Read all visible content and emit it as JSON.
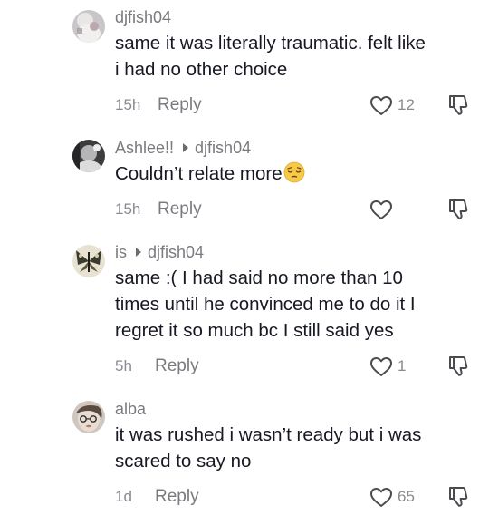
{
  "comments": [
    {
      "username": "djfish04",
      "reply_to": "",
      "text_lines": [
        "same it was literally traumatic. felt like",
        "i had no other choice"
      ],
      "time": "15h",
      "reply_label": "Reply",
      "likes": "12"
    },
    {
      "username": "Ashlee!!",
      "reply_to": "djfish04",
      "text_lines": [
        "Couldn’t relate more"
      ],
      "emoji": "pensive-face",
      "time": "15h",
      "reply_label": "Reply",
      "likes": ""
    },
    {
      "username": "is",
      "reply_to": "djfish04",
      "text_lines": [
        "same :( I had said no more than 10",
        "times until he convinced me to do it I",
        "regret it so much bc I still said yes"
      ],
      "time": "5h",
      "reply_label": "Reply",
      "likes": "1"
    },
    {
      "username": "alba",
      "reply_to": "",
      "text_lines": [
        "it was rushed i wasn’t ready but i was",
        "scared to say no"
      ],
      "time": "1d",
      "reply_label": "Reply",
      "likes": "65"
    }
  ],
  "icons": {
    "like": "heart-outline-icon",
    "dislike": "thumbs-down-icon",
    "reply_to": "triangle-right-icon"
  },
  "colors": {
    "text": "#161823",
    "secondary": "#7a7a7f",
    "icon": "#4a4a4f"
  }
}
